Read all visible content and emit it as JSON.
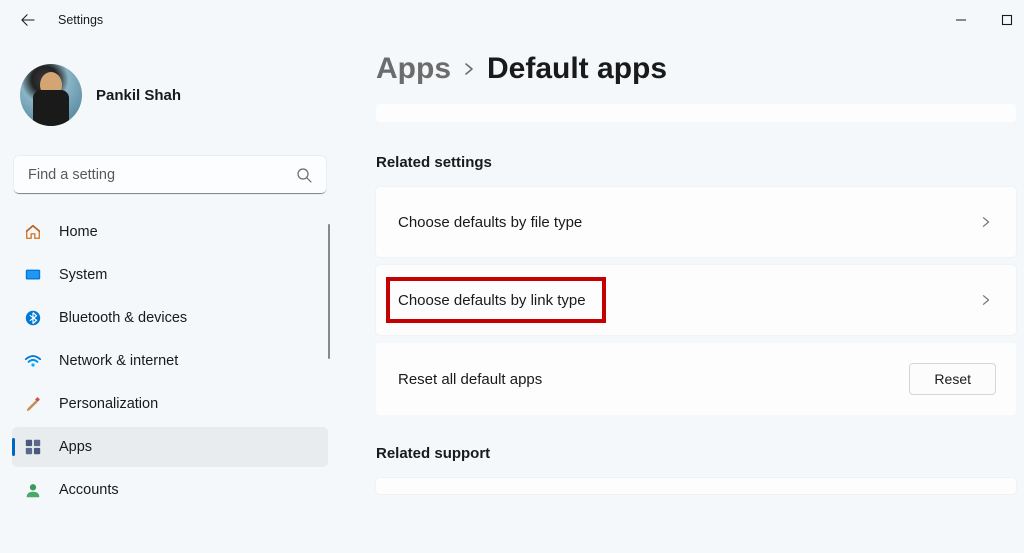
{
  "window": {
    "title": "Settings"
  },
  "profile": {
    "name": "Pankil Shah"
  },
  "search": {
    "placeholder": "Find a setting"
  },
  "sidebar": {
    "items": [
      {
        "label": "Home"
      },
      {
        "label": "System"
      },
      {
        "label": "Bluetooth & devices"
      },
      {
        "label": "Network & internet"
      },
      {
        "label": "Personalization"
      },
      {
        "label": "Apps"
      },
      {
        "label": "Accounts"
      }
    ],
    "active_index": 5
  },
  "breadcrumb": {
    "parent": "Apps",
    "current": "Default apps"
  },
  "main": {
    "related_settings_heading": "Related settings",
    "related_support_heading": "Related support",
    "rows": [
      {
        "label": "Choose defaults by file type"
      },
      {
        "label": "Choose defaults by link type"
      }
    ],
    "reset_row": {
      "label": "Reset all default apps",
      "button": "Reset"
    }
  },
  "highlighted_row_index": 1
}
